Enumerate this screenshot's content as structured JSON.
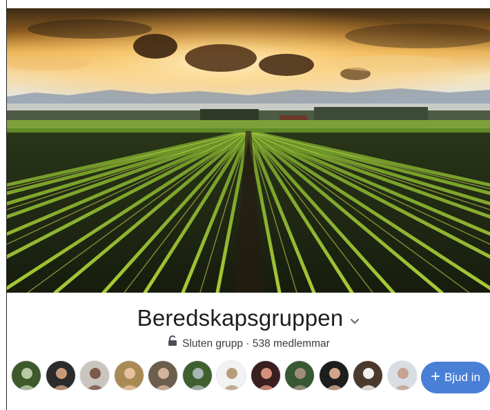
{
  "group": {
    "name": "Beredskapsgruppen",
    "privacy": "Sluten grupp",
    "separator": "·",
    "members": "538 medlemmar"
  },
  "invite_button": {
    "label": "Bjud in",
    "icon": "plus-icon"
  },
  "icons": {
    "chevron": "chevron-down-icon",
    "lock": "lock-open-icon"
  },
  "cover": {
    "description_icon": "cover-photo"
  },
  "members_preview": [
    {
      "name": "member-avatar-1",
      "colors": [
        "#3d5a2a",
        "#b7c9a7"
      ]
    },
    {
      "name": "member-avatar-2",
      "colors": [
        "#2b2b2b",
        "#c79a7a"
      ]
    },
    {
      "name": "member-avatar-3",
      "colors": [
        "#c9c4bd",
        "#7b5a4a"
      ]
    },
    {
      "name": "member-avatar-4",
      "colors": [
        "#a98a55",
        "#e7c19d"
      ]
    },
    {
      "name": "member-avatar-5",
      "colors": [
        "#6d5d4d",
        "#d1b49a"
      ]
    },
    {
      "name": "member-avatar-6",
      "colors": [
        "#3f5f2e",
        "#a7b5b5"
      ]
    },
    {
      "name": "member-avatar-7",
      "colors": [
        "#f2f2f2",
        "#b89c7a"
      ]
    },
    {
      "name": "member-avatar-8",
      "colors": [
        "#3a1f1f",
        "#d7907a"
      ]
    },
    {
      "name": "member-avatar-9",
      "colors": [
        "#385833",
        "#9c8f7c"
      ]
    },
    {
      "name": "member-avatar-10",
      "colors": [
        "#1d1d1d",
        "#d2a48a"
      ]
    },
    {
      "name": "member-avatar-11",
      "colors": [
        "#4b3a2b",
        "#f1f1f1"
      ]
    },
    {
      "name": "member-avatar-12",
      "colors": [
        "#d8dde3",
        "#c5a38e"
      ]
    }
  ],
  "colors": {
    "button": "#4a7fd6",
    "title": "#1c1e21",
    "meta": "#3a3b3c"
  }
}
